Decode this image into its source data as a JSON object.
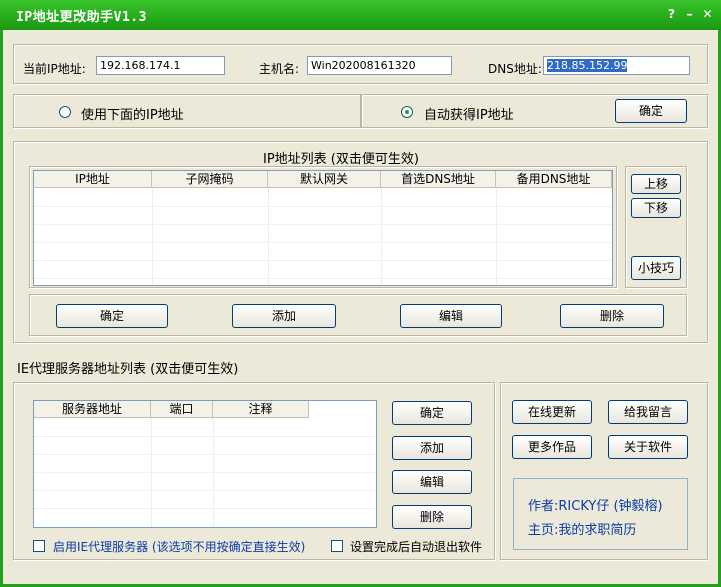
{
  "window": {
    "title": "IP地址更改助手V1.3",
    "buttons": {
      "help": "?",
      "minimize": "–",
      "close": "✕"
    }
  },
  "current": {
    "ip_label": "当前IP地址:",
    "ip_value": "192.168.174.1",
    "host_label": "主机名:",
    "host_value": "Win202008161320",
    "dns_label": "DNS地址:",
    "dns_value": "218.85.152.99"
  },
  "mode": {
    "manual_label": "使用下面的IP地址",
    "auto_label": "自动获得IP地址",
    "selected": "auto",
    "confirm_label": "确定"
  },
  "ip_list": {
    "title": "IP地址列表 (双击便可生效)",
    "columns": [
      "IP地址",
      "子网掩码",
      "默认网关",
      "首选DNS地址",
      "备用DNS地址"
    ],
    "rows": [],
    "move_up_label": "上移",
    "move_down_label": "下移",
    "tips_label": "小技巧",
    "confirm_label": "确定",
    "add_label": "添加",
    "edit_label": "编辑",
    "delete_label": "删除"
  },
  "proxy": {
    "title": "IE代理服务器地址列表 (双击便可生效)",
    "columns": [
      "服务器地址",
      "端口",
      "注释"
    ],
    "rows": [],
    "confirm_label": "确定",
    "add_label": "添加",
    "edit_label": "编辑",
    "delete_label": "删除",
    "enable_label": "启用IE代理服务器 (该选项不用按确定直接生效)",
    "enable_checked": false,
    "autoexit_label": "设置完成后自动退出软件",
    "autoexit_checked": false
  },
  "side": {
    "update_label": "在线更新",
    "message_label": "给我留言",
    "more_label": "更多作品",
    "about_label": "关于软件",
    "author_text": "作者:RICKY仔 (钟毅榕)",
    "homepage_text": "主页:我的求职简历"
  }
}
